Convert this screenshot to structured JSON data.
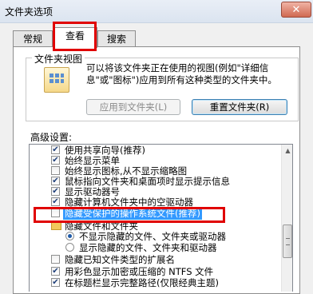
{
  "window": {
    "title": "文件夹选项",
    "close_glyph": "✕"
  },
  "tabs": [
    {
      "label": "常规"
    },
    {
      "label": "查看"
    },
    {
      "label": "搜索"
    }
  ],
  "folder_view": {
    "heading": "文件夹视图",
    "description": "可以将该文件夹正在使用的视图(例如\"详细信息\"或\"图标\")应用到所有这种类型的文件夹中。",
    "apply_button": "应用到文件夹(L)",
    "reset_button": "重置文件夹(R)"
  },
  "advanced": {
    "label": "高级设置:",
    "rows": [
      {
        "kind": "checkbox",
        "checked": true,
        "text": "使用共享向导(推荐)"
      },
      {
        "kind": "checkbox",
        "checked": true,
        "text": "始终显示菜单"
      },
      {
        "kind": "checkbox",
        "checked": false,
        "text": "始终显示图标,从不显示缩略图"
      },
      {
        "kind": "checkbox",
        "checked": true,
        "text": "鼠标指向文件夹和桌面项时显示提示信息"
      },
      {
        "kind": "checkbox",
        "checked": true,
        "text": "显示驱动器号"
      },
      {
        "kind": "checkbox",
        "checked": true,
        "text": "隐藏计算机文件夹中的空驱动器"
      },
      {
        "kind": "checkbox",
        "checked": false,
        "text": "隐藏受保护的操作系统文件(推荐)",
        "selected": true
      },
      {
        "kind": "folder",
        "text": "隐藏文件和文件夹"
      },
      {
        "kind": "radio",
        "checked": true,
        "text": "不显示隐藏的文件、文件夹或驱动器"
      },
      {
        "kind": "radio",
        "checked": false,
        "text": "显示隐藏的文件、文件夹和驱动器"
      },
      {
        "kind": "checkbox",
        "checked": false,
        "text": "隐藏已知文件类型的扩展名"
      },
      {
        "kind": "checkbox",
        "checked": true,
        "text": "用彩色显示加密或压缩的 NTFS 文件"
      },
      {
        "kind": "checkbox",
        "checked": true,
        "text": "在标题栏显示完整路径(仅限经典主题)"
      }
    ]
  },
  "scrollbar": {
    "up_glyph": "▲"
  },
  "colors": {
    "highlight": "#3399ff",
    "annotation_red": "#e00000"
  }
}
